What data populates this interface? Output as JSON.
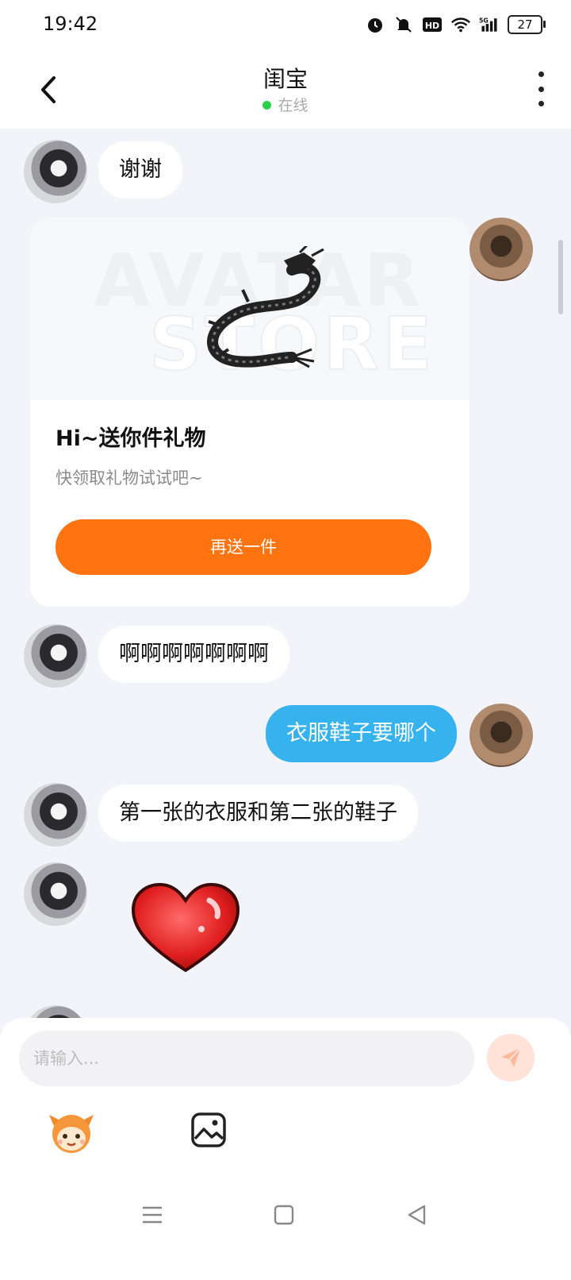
{
  "status_bar": {
    "time": "19:42",
    "battery": "27"
  },
  "header": {
    "title": "闺宝",
    "status": "在线"
  },
  "messages": [
    {
      "side": "in",
      "text": "谢谢"
    },
    {
      "side": "out",
      "type": "gift",
      "gift": {
        "title": "Hi~送你件礼物",
        "subtitle": "快领取礼物试试吧~",
        "button": "再送一件",
        "watermark_line1": "AVATAR",
        "watermark_line2": "STORE"
      }
    },
    {
      "side": "in",
      "text": "啊啊啊啊啊啊啊"
    },
    {
      "side": "out",
      "text": "衣服鞋子要哪个"
    },
    {
      "side": "in",
      "text": "第一张的衣服和第二张的鞋子"
    },
    {
      "side": "in",
      "type": "sticker",
      "sticker": "heart-sticker"
    }
  ],
  "input": {
    "placeholder": "请输入..."
  },
  "colors": {
    "accent": "#ff7411",
    "outgoing_bubble": "#36b3ee",
    "online_dot": "#2bd04b"
  },
  "icons": [
    "back-arrow-icon",
    "more-vert-icon",
    "alarm-icon",
    "mute-icon",
    "hd-icon",
    "wifi-icon",
    "signal-5g-icon",
    "send-icon",
    "sticker-mascot-icon",
    "image-icon"
  ]
}
